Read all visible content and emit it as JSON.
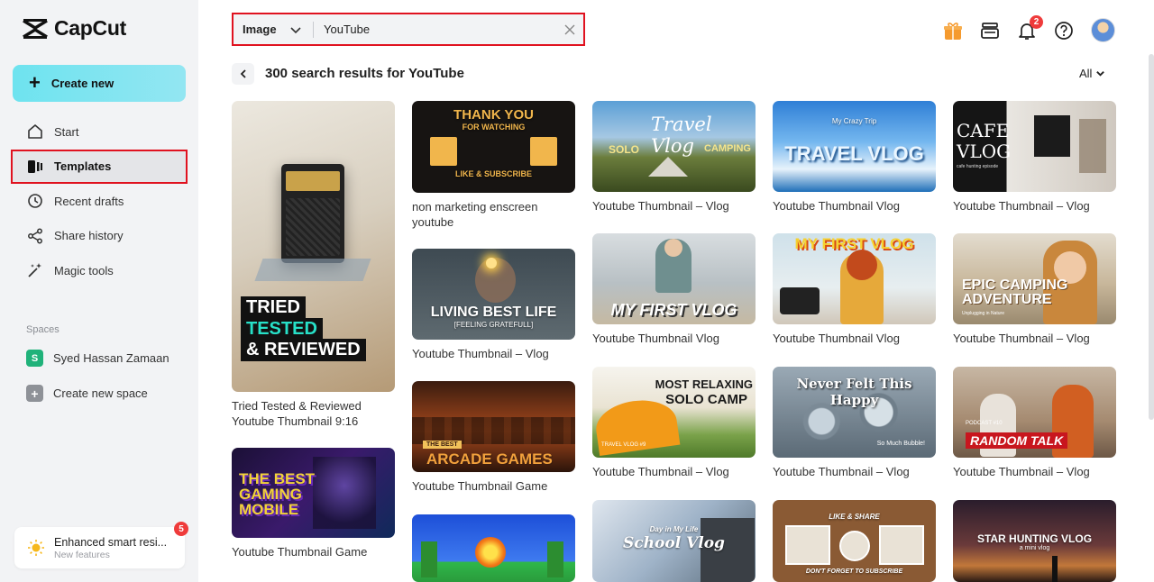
{
  "app": {
    "name": "CapCut"
  },
  "sidebar": {
    "create_label": "Create new",
    "items": [
      {
        "label": "Start",
        "icon": "home-icon"
      },
      {
        "label": "Templates",
        "icon": "templates-icon"
      },
      {
        "label": "Recent drafts",
        "icon": "clock-icon"
      },
      {
        "label": "Share history",
        "icon": "share-icon"
      },
      {
        "label": "Magic tools",
        "icon": "magic-wand-icon"
      }
    ],
    "spaces_label": "Spaces",
    "space_name": "Syed Hassan Zamaan",
    "space_initial": "S",
    "create_space": "Create new space",
    "feature_title": "Enhanced smart resi...",
    "feature_sub": "New features",
    "feature_badge": "5"
  },
  "search": {
    "type": "Image",
    "value": "YouTube"
  },
  "header": {
    "notif_count": "2",
    "results_title": "300 search results for YouTube",
    "filter": "All"
  },
  "cards": [
    {
      "caption": "Tried Tested & Reviewed Youtube Thumbnail 9:16",
      "t1": "TRIED",
      "t2": "TESTED",
      "t3": "& REVIEWED"
    },
    {
      "caption": "Youtube Thumbnail Game",
      "t1": "THE BEST",
      "t2": "GAMING",
      "t3": "MOBILE"
    },
    {
      "caption": "non marketing enscreen youtube",
      "t1": "THANK YOU",
      "t2": "FOR WATCHING",
      "t3": "LIKE & SUBSCRIBE"
    },
    {
      "caption": "Youtube Thumbnail – Vlog",
      "t1": "LIVING BEST LIFE",
      "t2": "[FEELING GRATEFULL]"
    },
    {
      "caption": "Youtube Thumbnail Game",
      "t1": "THE BEST",
      "t2": "ARCADE GAMES"
    },
    {
      "caption": "",
      "t1": ""
    },
    {
      "caption": "Youtube Thumbnail – Vlog",
      "t1": "Travel Vlog",
      "t2": "SOLO",
      "t3": "CAMPING"
    },
    {
      "caption": "Youtube Thumbnail Vlog",
      "t1": "MY FIRST VLOG"
    },
    {
      "caption": "Youtube Thumbnail – Vlog",
      "t1": "MOST RELAXING",
      "t2": "SOLO CAMP",
      "t3": "TRAVEL VLOG #9"
    },
    {
      "caption": "",
      "t1": "Day in My Life",
      "t2": "School Vlog"
    },
    {
      "caption": "Youtube Thumbnail Vlog",
      "t1": "TRAVEL VLOG",
      "t2": "My Crazy Trip"
    },
    {
      "caption": "Youtube Thumbnail Vlog",
      "t1": "MY FIRST VLOG"
    },
    {
      "caption": "Youtube Thumbnail – Vlog",
      "t1": "Never Felt This Happy",
      "t2": "So Much Bubble!"
    },
    {
      "caption": "",
      "t1": "LIKE & SHARE",
      "t2": "DON'T FORGET TO SUBSCRIBE"
    },
    {
      "caption": "Youtube Thumbnail – Vlog",
      "t1": "CAFE",
      "t2": "VLOG",
      "t3": "cafe hunting episode"
    },
    {
      "caption": "Youtube Thumbnail – Vlog",
      "t1": "EPIC CAMPING",
      "t2": "ADVENTURE",
      "t3": "Unplugging in Nature"
    },
    {
      "caption": "Youtube Thumbnail – Vlog",
      "t1": "PODCAST #10",
      "t2": "RANDOM TALK"
    },
    {
      "caption": "",
      "t1": "STAR HUNTING VLOG",
      "t2": "a mini vlog"
    }
  ]
}
